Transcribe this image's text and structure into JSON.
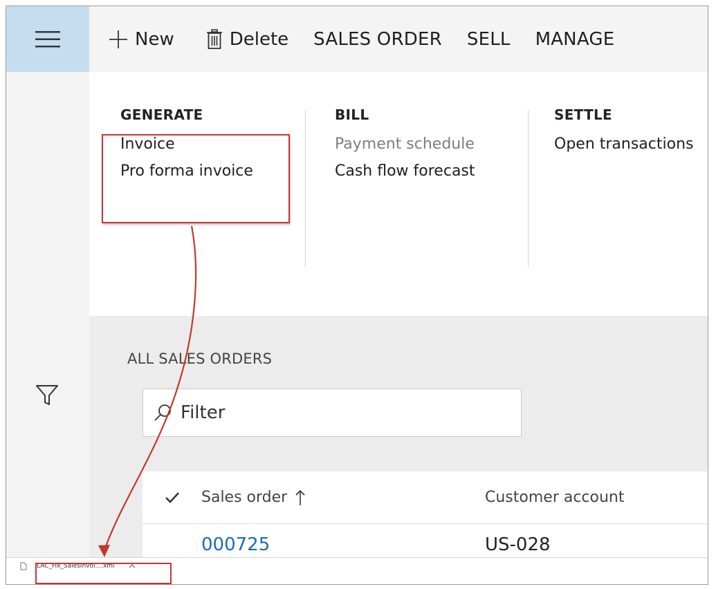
{
  "actionbar": {
    "new_label": "New",
    "delete_label": "Delete",
    "tabs": [
      "SALES ORDER",
      "SELL",
      "MANAGE"
    ]
  },
  "ribbon": {
    "groups": [
      {
        "header": "GENERATE",
        "items": [
          "Invoice",
          "Pro forma invoice"
        ]
      },
      {
        "header": "BILL",
        "items": [
          "Payment schedule",
          "Cash flow forecast"
        ]
      },
      {
        "header": "SETTLE",
        "items": [
          "Open transactions"
        ]
      }
    ]
  },
  "list": {
    "title": "ALL SALES ORDERS",
    "filter_placeholder": "Filter",
    "columns": [
      "Sales order",
      "Customer account"
    ],
    "rows": [
      {
        "sales_order": "000725",
        "customer_account": "US-028"
      }
    ]
  },
  "download": {
    "filename": "LAC_Fix_SalesInvoi....xml"
  },
  "colors": {
    "highlight": "#cc3333",
    "link": "#1b6cb3",
    "nav_active": "#c6ddf0"
  }
}
